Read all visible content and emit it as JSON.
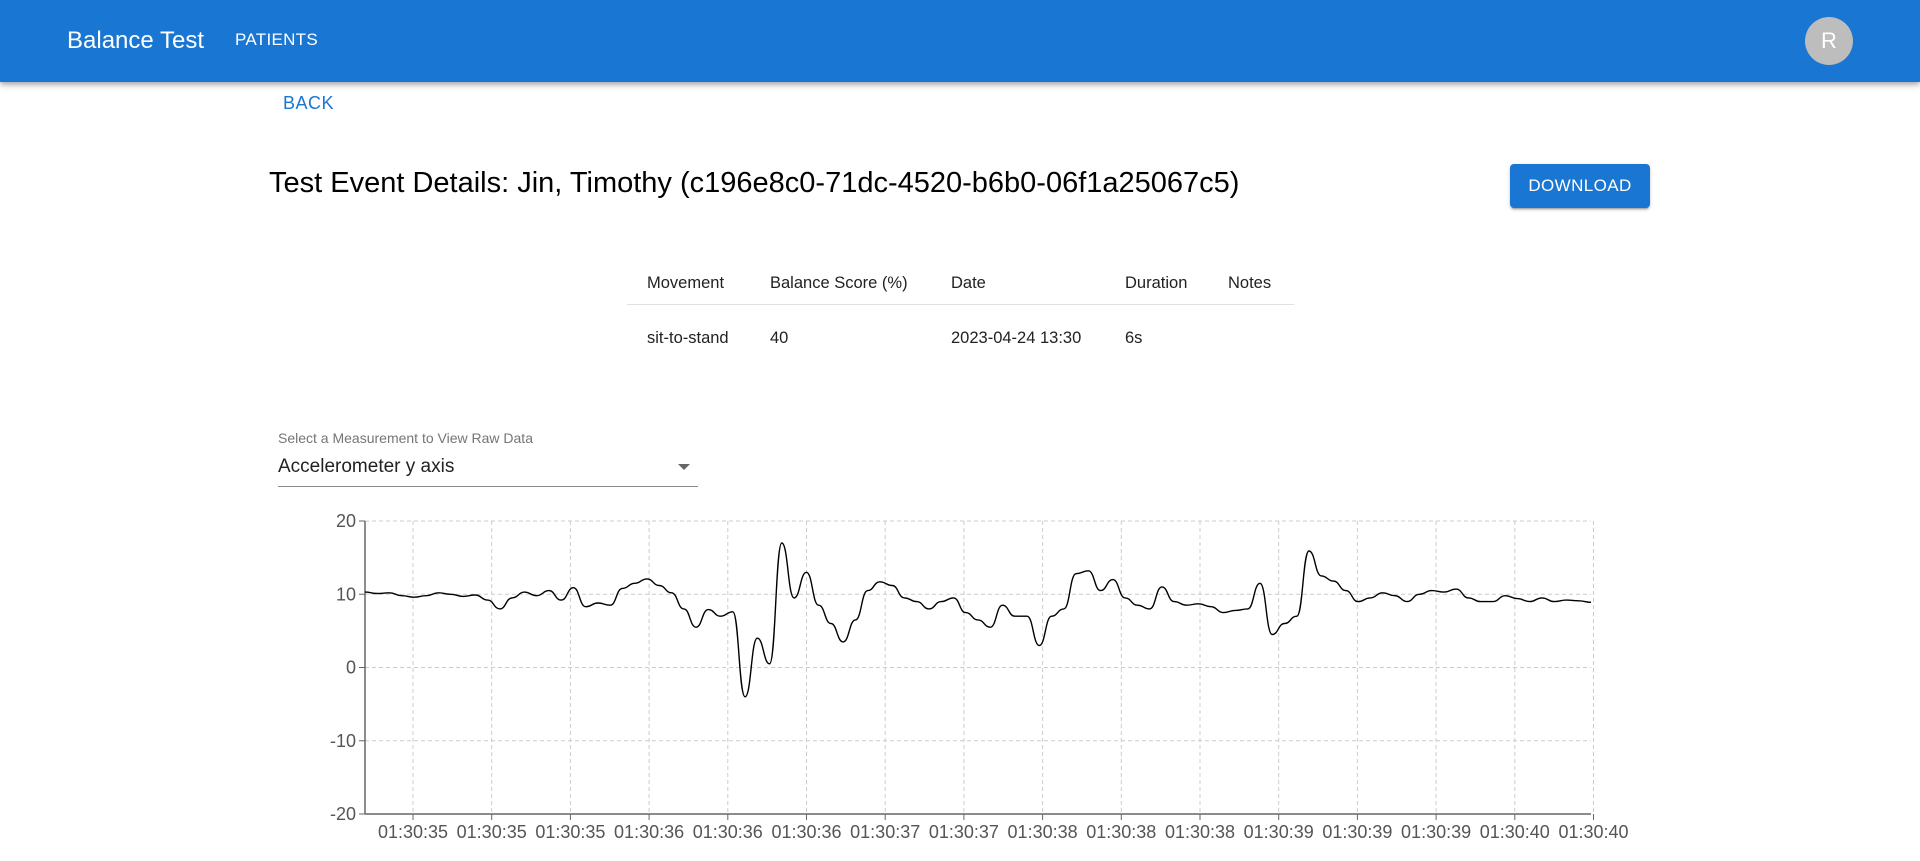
{
  "appbar": {
    "title": "Balance Test",
    "nav_patients": "PATIENTS",
    "avatar_initial": "R"
  },
  "back_label": "BACK",
  "page_title": "Test Event Details: Jin, Timothy (c196e8c0-71dc-4520-b6b0-06f1a25067c5)",
  "download_label": "DOWNLOAD",
  "table": {
    "headers": [
      "Movement",
      "Balance Score (%)",
      "Date",
      "Duration",
      "Notes"
    ],
    "row": [
      "sit-to-stand",
      "40",
      "2023-04-24 13:30",
      "6s",
      ""
    ]
  },
  "select": {
    "label": "Select a Measurement to View Raw Data",
    "value": "Accelerometer y axis"
  },
  "colors": {
    "primary": "#1976d2",
    "line": "#000000",
    "grid": "#cccccc"
  },
  "chart_data": {
    "type": "line",
    "ylim": [
      -20,
      20
    ],
    "y_ticks": [
      20,
      10,
      0,
      -10,
      -20
    ],
    "x_ticks": [
      "01:30:35",
      "01:30:35",
      "01:30:35",
      "01:30:36",
      "01:30:36",
      "01:30:36",
      "01:30:37",
      "01:30:37",
      "01:30:38",
      "01:30:38",
      "01:30:38",
      "01:30:39",
      "01:30:39",
      "01:30:39",
      "01:30:40",
      "01:30:40"
    ],
    "grid": true,
    "x": [
      0,
      0.01,
      0.02,
      0.03,
      0.04,
      0.05,
      0.06,
      0.07,
      0.08,
      0.09,
      0.1,
      0.11,
      0.12,
      0.13,
      0.14,
      0.15,
      0.16,
      0.17,
      0.18,
      0.19,
      0.2,
      0.21,
      0.22,
      0.23,
      0.24,
      0.25,
      0.26,
      0.27,
      0.28,
      0.29,
      0.3,
      0.31,
      0.32,
      0.33,
      0.34,
      0.35,
      0.36,
      0.37,
      0.38,
      0.39,
      0.4,
      0.41,
      0.42,
      0.43,
      0.44,
      0.45,
      0.46,
      0.47,
      0.48,
      0.49,
      0.5,
      0.51,
      0.52,
      0.53,
      0.54,
      0.55,
      0.56,
      0.57,
      0.58,
      0.59,
      0.6,
      0.61,
      0.62,
      0.63,
      0.64,
      0.65,
      0.66,
      0.67,
      0.68,
      0.69,
      0.7,
      0.71,
      0.72,
      0.73,
      0.74,
      0.75,
      0.76,
      0.77,
      0.78,
      0.79,
      0.8,
      0.81,
      0.82,
      0.83,
      0.84,
      0.85,
      0.86,
      0.87,
      0.88,
      0.89,
      0.9,
      0.91,
      0.92,
      0.93,
      0.94,
      0.95,
      0.96,
      0.97,
      0.98,
      0.99,
      1.0
    ],
    "series": [
      {
        "values": [
          10.3,
          10.1,
          10.2,
          9.8,
          9.6,
          9.8,
          10.2,
          10.0,
          9.7,
          9.9,
          9.2,
          8.0,
          9.5,
          10.3,
          9.8,
          10.5,
          9.2,
          10.9,
          8.3,
          8.8,
          8.5,
          10.8,
          11.5,
          12.1,
          11.2,
          10.2,
          8.0,
          5.5,
          7.9,
          7.0,
          7.6,
          -4.0,
          4.0,
          0.5,
          17.0,
          9.5,
          13.0,
          8.5,
          6.0,
          3.5,
          6.5,
          10.5,
          11.7,
          11.2,
          9.5,
          9.0,
          8.0,
          9.0,
          9.5,
          7.5,
          6.5,
          5.5,
          8.5,
          7.0,
          7.0,
          3.0,
          7.0,
          8.0,
          12.8,
          13.2,
          10.5,
          12.0,
          9.5,
          8.5,
          8.0,
          11.0,
          9.0,
          8.5,
          8.7,
          8.3,
          7.5,
          7.8,
          8.0,
          11.5,
          4.5,
          6.0,
          7.0,
          15.9,
          12.5,
          11.8,
          10.5,
          9.0,
          9.5,
          10.2,
          9.8,
          9.0,
          10.0,
          10.5,
          10.3,
          10.7,
          9.5,
          9.0,
          9.0,
          9.8,
          9.4,
          9.0,
          9.5,
          9.0,
          9.2,
          9.1,
          8.9
        ]
      }
    ]
  }
}
